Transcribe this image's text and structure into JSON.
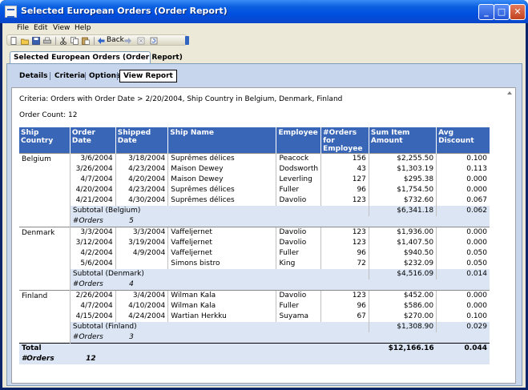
{
  "window": {
    "title": "Selected European Orders (Order Report)",
    "controls": {
      "minimize": "_",
      "maximize": "□",
      "close": "✕"
    }
  },
  "menu": {
    "file": "File",
    "edit": "Edit",
    "view": "View",
    "help": "Help"
  },
  "toolbar": {
    "back_label": "Back"
  },
  "doc_tab": "Selected European Orders (Order Report)",
  "subtabs": {
    "details": "Details",
    "criteria": "Criteria",
    "options": "Options",
    "view_report": "View Report"
  },
  "report": {
    "criteria": "Criteria: Orders with Order Date > 2/20/2004, Ship Country in Belgium, Denmark, Finland",
    "order_count": "Order Count: 12",
    "columns": [
      "Ship Country",
      "Order Date",
      "Shipped Date",
      "Ship Name",
      "Employee",
      "#Orders for Employee",
      "Sum Item Amount",
      "Avg Discount"
    ],
    "groups": [
      {
        "country": "Belgium",
        "rows": [
          [
            "3/6/2004",
            "3/18/2004",
            "Suprêmes délices",
            "Peacock",
            "156",
            "$2,255.50",
            "0.100"
          ],
          [
            "3/26/2004",
            "4/23/2004",
            "Maison Dewey",
            "Dodsworth",
            "43",
            "$1,303.19",
            "0.113"
          ],
          [
            "4/7/2004",
            "4/20/2004",
            "Maison Dewey",
            "Leverling",
            "127",
            "$295.38",
            "0.000"
          ],
          [
            "4/20/2004",
            "4/23/2004",
            "Suprêmes délices",
            "Fuller",
            "96",
            "$1,754.50",
            "0.000"
          ],
          [
            "4/21/2004",
            "4/30/2004",
            "Suprêmes délices",
            "Davolio",
            "123",
            "$732.60",
            "0.067"
          ]
        ],
        "subtotal_label": "Subtotal (Belgium)",
        "subtotal_amount": "$6,341.18",
        "subtotal_discount": "0.062",
        "orders_label": "#Orders",
        "orders_count": "5"
      },
      {
        "country": "Denmark",
        "rows": [
          [
            "3/3/2004",
            "3/3/2004",
            "Vaffeljernet",
            "Davolio",
            "123",
            "$1,936.00",
            "0.000"
          ],
          [
            "3/12/2004",
            "3/19/2004",
            "Vaffeljernet",
            "Davolio",
            "123",
            "$1,407.50",
            "0.000"
          ],
          [
            "4/2/2004",
            "4/9/2004",
            "Vaffeljernet",
            "Fuller",
            "96",
            "$940.50",
            "0.050"
          ],
          [
            "5/6/2004",
            "",
            "Simons bistro",
            "King",
            "72",
            "$232.09",
            "0.050"
          ]
        ],
        "subtotal_label": "Subtotal (Denmark)",
        "subtotal_amount": "$4,516.09",
        "subtotal_discount": "0.014",
        "orders_label": "#Orders",
        "orders_count": "4"
      },
      {
        "country": "Finland",
        "rows": [
          [
            "2/26/2004",
            "3/4/2004",
            "Wilman Kala",
            "Davolio",
            "123",
            "$452.00",
            "0.000"
          ],
          [
            "4/7/2004",
            "4/10/2004",
            "Wilman Kala",
            "Fuller",
            "96",
            "$586.00",
            "0.000"
          ],
          [
            "4/15/2004",
            "4/24/2004",
            "Wartian Herkku",
            "Suyama",
            "67",
            "$270.00",
            "0.100"
          ]
        ],
        "subtotal_label": "Subtotal (Finland)",
        "subtotal_amount": "$1,308.90",
        "subtotal_discount": "0.029",
        "orders_label": "#Orders",
        "orders_count": "3"
      }
    ],
    "total": {
      "label": "Total",
      "amount": "$12,166.16",
      "discount": "0.044",
      "orders_label": "#Orders",
      "orders_count": "12"
    }
  }
}
